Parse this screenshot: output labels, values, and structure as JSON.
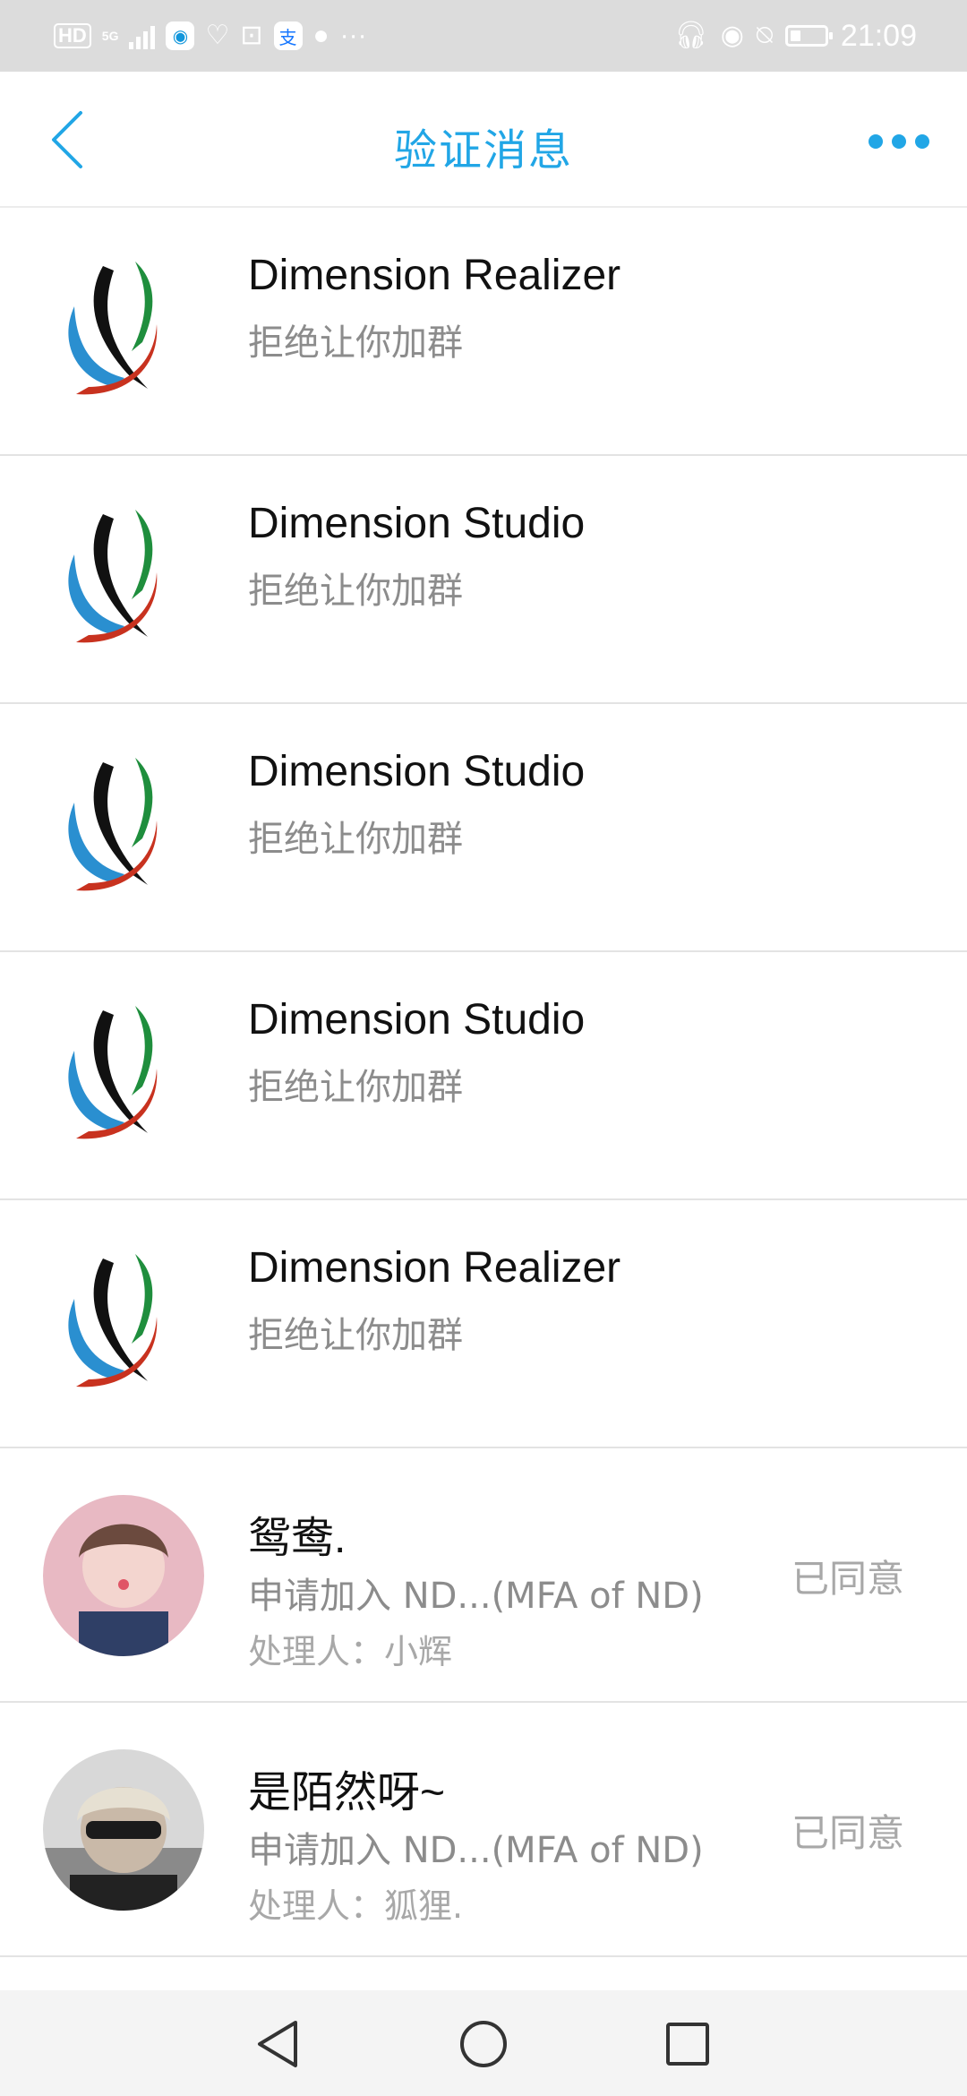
{
  "status_bar": {
    "hd": "HD",
    "network": "5G",
    "more": "···",
    "time": "21:09",
    "battery_level": 0.3,
    "icons": [
      "signal-icon",
      "qq-app-icon",
      "health-icon",
      "bilibili-icon",
      "alipay-icon",
      "chat-bubble-icon",
      "headphones-icon",
      "eye-icon",
      "mute-icon",
      "battery-icon"
    ]
  },
  "header": {
    "title": "验证消息",
    "accent_color": "#21a6e6"
  },
  "messages": [
    {
      "name": "Dimension Realizer",
      "text": "拒绝让你加群"
    },
    {
      "name": "Dimension Studio",
      "text": "拒绝让你加群"
    },
    {
      "name": "Dimension Studio",
      "text": "拒绝让你加群"
    },
    {
      "name": "Dimension Studio",
      "text": "拒绝让你加群"
    },
    {
      "name": "Dimension Realizer",
      "text": "拒绝让你加群"
    },
    {
      "name": "鸳鸯.",
      "text": "申请加入 ND...(MFA of ND)",
      "handler": "处理人：小辉",
      "status": "已同意"
    },
    {
      "name": "是陌然呀~",
      "text": "申请加入 ND...(MFA of ND)",
      "handler": "处理人：狐狸.",
      "status": "已同意"
    }
  ]
}
